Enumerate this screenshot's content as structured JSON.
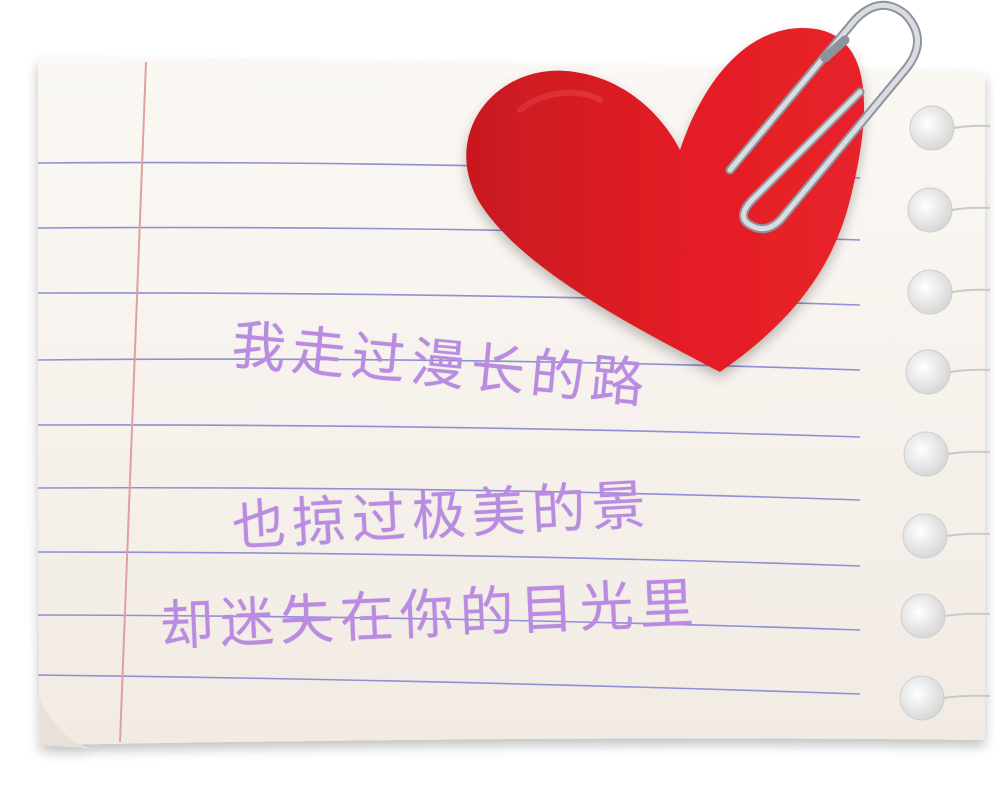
{
  "poem": {
    "line1": "我走过漫长的路",
    "line2": "也掠过极美的景",
    "line3": "却迷失在你的目光里"
  },
  "colors": {
    "paper": "#f8f3ee",
    "rule_line": "#8f8fd6",
    "margin_line": "#e0a0a0",
    "heart": "#e01e24",
    "heart_dark": "#b3161b",
    "text": "#b98ce2",
    "clip": "#b8bcc4"
  },
  "icons": {
    "heart": "heart-icon",
    "clip": "paperclip-icon",
    "holes": "punch-hole-icon"
  }
}
